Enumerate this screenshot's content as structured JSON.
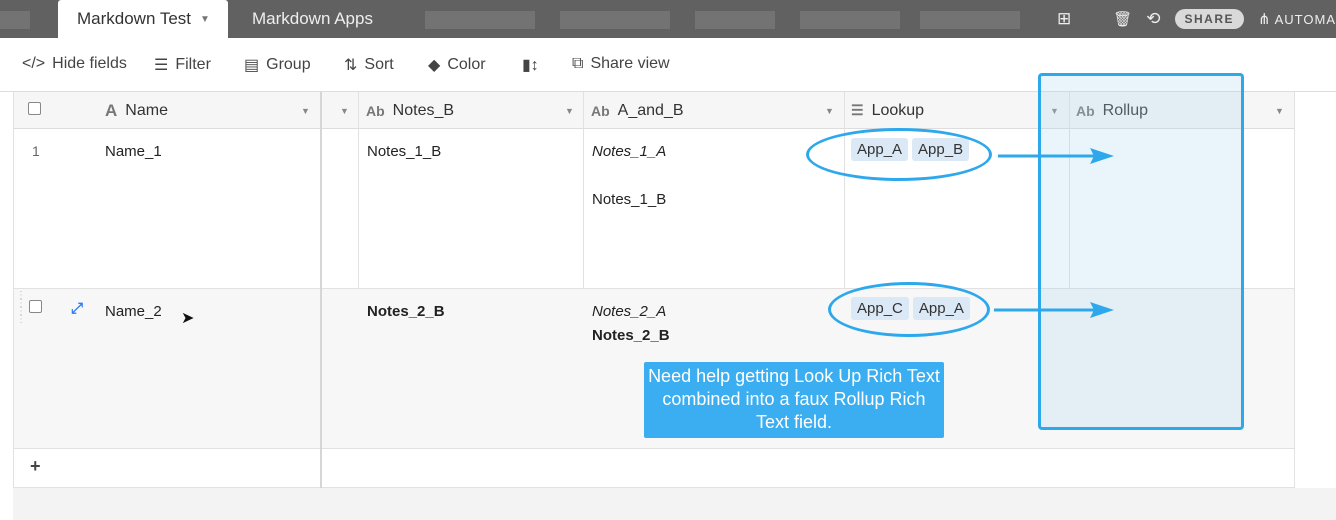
{
  "tabs": {
    "active": "Markdown Test",
    "inactive": "Markdown Apps"
  },
  "topbar": {
    "share_label": "SHARE",
    "automations_label": "AUTOMA"
  },
  "toolbar": {
    "hide_fields": "Hide fields",
    "filter": "Filter",
    "group": "Group",
    "sort": "Sort",
    "color": "Color",
    "share_view": "Share view"
  },
  "columns": {
    "name": "Name",
    "notes_b": "Notes_B",
    "a_and_b": "A_and_B",
    "lookup": "Lookup",
    "rollup": "Rollup"
  },
  "rows": [
    {
      "number": "1",
      "name": "Name_1",
      "notes_b": "Notes_1_B",
      "a_and_b_line1": "Notes_1_A",
      "a_and_b_line2": "Notes_1_B",
      "lookup": [
        "App_A",
        "App_B"
      ]
    },
    {
      "number": "",
      "name": "Name_2",
      "notes_b": "Notes_2_B",
      "a_and_b_line1": "Notes_2_A",
      "a_and_b_line2": "Notes_2_B",
      "lookup": [
        "App_C",
        "App_A"
      ]
    }
  ],
  "add_row_label": "+",
  "callout_text": "Need help getting Look Up Rich Text combined into a faux Rollup Rich Text field.",
  "colors": {
    "annotation": "#2ea8ec",
    "callout_bg": "#3aaef0",
    "chip_bg": "#dbe8f5",
    "topbar_bg": "#616161"
  }
}
